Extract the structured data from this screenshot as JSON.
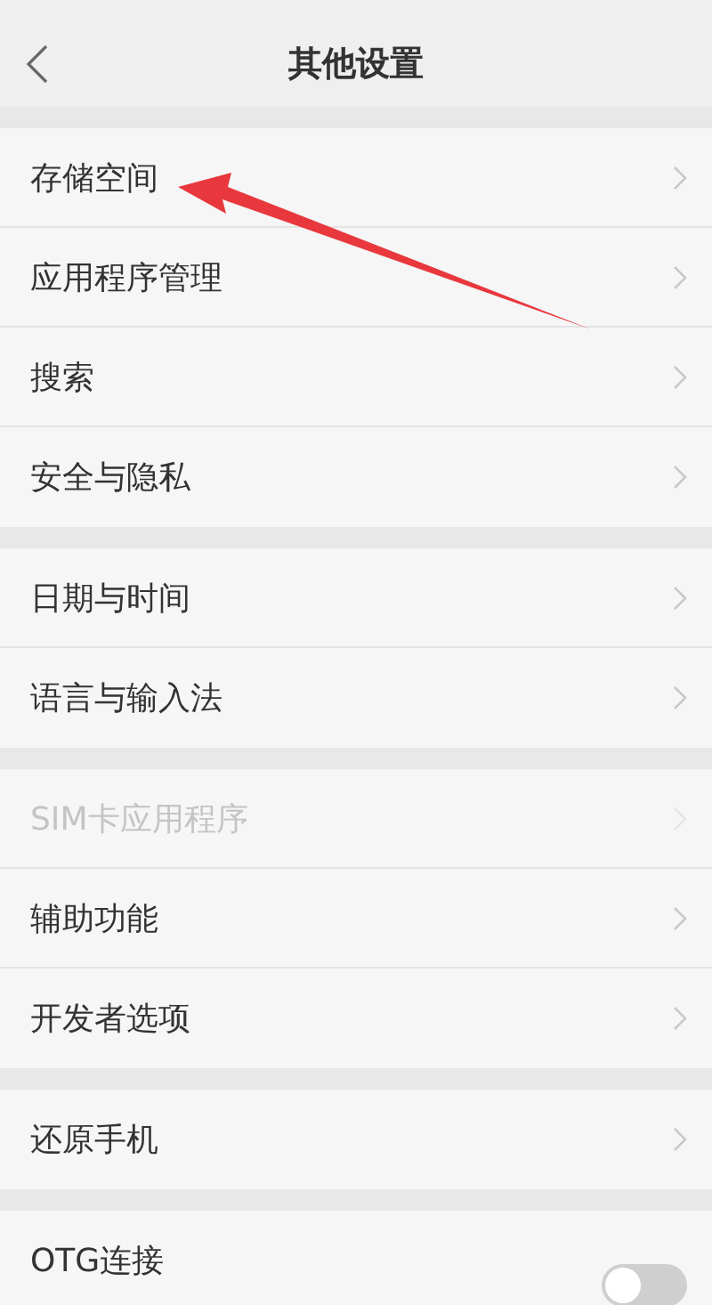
{
  "header": {
    "title": "其他设置"
  },
  "groups": [
    {
      "items": [
        {
          "label": "存储空间",
          "kind": "link",
          "disabled": false
        },
        {
          "label": "应用程序管理",
          "kind": "link",
          "disabled": false
        },
        {
          "label": "搜索",
          "kind": "link",
          "disabled": false
        },
        {
          "label": "安全与隐私",
          "kind": "link",
          "disabled": false
        }
      ]
    },
    {
      "items": [
        {
          "label": "日期与时间",
          "kind": "link",
          "disabled": false
        },
        {
          "label": "语言与输入法",
          "kind": "link",
          "disabled": false
        }
      ]
    },
    {
      "items": [
        {
          "label": "SIM卡应用程序",
          "kind": "link",
          "disabled": true
        },
        {
          "label": "辅助功能",
          "kind": "link",
          "disabled": false
        },
        {
          "label": "开发者选项",
          "kind": "link",
          "disabled": false
        }
      ]
    },
    {
      "items": [
        {
          "label": "还原手机",
          "kind": "link",
          "disabled": false
        }
      ]
    },
    {
      "items": [
        {
          "label": "OTG连接",
          "kind": "toggle",
          "disabled": false,
          "on": false
        }
      ]
    }
  ]
}
